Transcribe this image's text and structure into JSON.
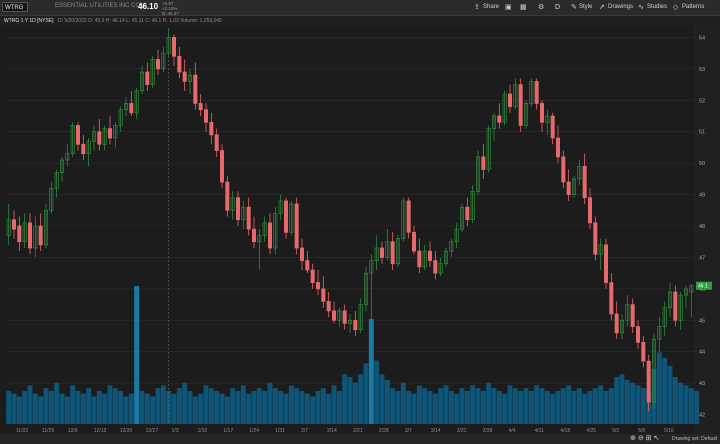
{
  "header": {
    "symbol": "WTRG",
    "company": "ESSENTIAL UTILITIES INC COM",
    "last_price": "46.10",
    "change_top": "+0.97",
    "change_mid": "+2.15%",
    "change_bot": "B: 46.07",
    "buttons": {
      "share": "Share",
      "style": "Style",
      "drawings": "Drawings",
      "studies": "Studies",
      "patterns": "Patterns"
    }
  },
  "subheader": {
    "symbol_label": "WTRG 1 Y 1D [NYSE]",
    "ohlc": "D: 5/20/2022   O: 45.9   H: 46.14   L: 45.11   C: 46.1   R: 1.03   Volume: 1,259,045"
  },
  "footer": {
    "drawing_set": "Drawing set: Default"
  },
  "colors": {
    "up": "#2e8b3e",
    "down": "#e8696c",
    "volume": "#0f5577",
    "volume_highlight": "#1a7aa8",
    "price_tag": "#2ea043"
  },
  "chart_data": {
    "type": "candlestick",
    "y_ticks": [
      54,
      53,
      52,
      51,
      50,
      49,
      48,
      47,
      46,
      45,
      44,
      43,
      42
    ],
    "ylim": [
      41.7,
      54.3
    ],
    "x_labels": [
      "11/22",
      "11/29",
      "12/6",
      "12/13",
      "12/20",
      "12/27",
      "1/3",
      "1/10",
      "1/17",
      "1/24",
      "1/31",
      "2/7",
      "2/14",
      "2/21",
      "2/28",
      "3/7",
      "3/14",
      "3/21",
      "3/28",
      "4/4",
      "4/11",
      "4/18",
      "4/25",
      "5/2",
      "5/9",
      "5/16"
    ],
    "last_price_tag": "46.1",
    "candles": [
      {
        "o": 47.7,
        "h": 48.7,
        "l": 47.4,
        "c": 48.2
      },
      {
        "o": 48.2,
        "h": 48.5,
        "l": 47.6,
        "c": 47.9
      },
      {
        "o": 48.0,
        "h": 48.3,
        "l": 47.2,
        "c": 47.5
      },
      {
        "o": 47.5,
        "h": 48.4,
        "l": 47.3,
        "c": 48.1
      },
      {
        "o": 48.1,
        "h": 48.4,
        "l": 47.1,
        "c": 47.3
      },
      {
        "o": 47.3,
        "h": 48.3,
        "l": 47.0,
        "c": 48.0
      },
      {
        "o": 48.0,
        "h": 48.4,
        "l": 47.2,
        "c": 47.4
      },
      {
        "o": 47.4,
        "h": 48.7,
        "l": 47.3,
        "c": 48.5
      },
      {
        "o": 48.5,
        "h": 49.4,
        "l": 48.4,
        "c": 49.2
      },
      {
        "o": 49.2,
        "h": 49.8,
        "l": 48.9,
        "c": 49.7
      },
      {
        "o": 49.7,
        "h": 50.2,
        "l": 49.4,
        "c": 50.1
      },
      {
        "o": 50.1,
        "h": 50.6,
        "l": 49.9,
        "c": 50.3
      },
      {
        "o": 50.3,
        "h": 51.3,
        "l": 50.2,
        "c": 51.2
      },
      {
        "o": 51.2,
        "h": 51.3,
        "l": 50.4,
        "c": 50.6
      },
      {
        "o": 50.6,
        "h": 50.9,
        "l": 50.1,
        "c": 50.3
      },
      {
        "o": 50.3,
        "h": 50.8,
        "l": 49.9,
        "c": 50.7
      },
      {
        "o": 50.7,
        "h": 51.2,
        "l": 50.4,
        "c": 51.0
      },
      {
        "o": 51.0,
        "h": 51.4,
        "l": 50.4,
        "c": 50.6
      },
      {
        "o": 50.6,
        "h": 51.2,
        "l": 50.4,
        "c": 51.1
      },
      {
        "o": 51.1,
        "h": 51.5,
        "l": 50.6,
        "c": 50.8
      },
      {
        "o": 50.8,
        "h": 51.3,
        "l": 50.5,
        "c": 51.2
      },
      {
        "o": 51.2,
        "h": 51.8,
        "l": 51.0,
        "c": 51.7
      },
      {
        "o": 51.7,
        "h": 52.1,
        "l": 51.5,
        "c": 51.9
      },
      {
        "o": 51.9,
        "h": 52.3,
        "l": 51.5,
        "c": 51.6
      },
      {
        "o": 51.6,
        "h": 52.4,
        "l": 51.4,
        "c": 52.3
      },
      {
        "o": 52.3,
        "h": 53.1,
        "l": 52.2,
        "c": 52.9
      },
      {
        "o": 52.9,
        "h": 53.2,
        "l": 52.3,
        "c": 52.5
      },
      {
        "o": 52.5,
        "h": 53.4,
        "l": 52.4,
        "c": 53.3
      },
      {
        "o": 53.3,
        "h": 53.6,
        "l": 52.8,
        "c": 53.0
      },
      {
        "o": 53.0,
        "h": 53.7,
        "l": 52.9,
        "c": 53.5
      },
      {
        "o": 53.5,
        "h": 54.3,
        "l": 53.4,
        "c": 54.0
      },
      {
        "o": 54.0,
        "h": 54.1,
        "l": 53.1,
        "c": 53.4
      },
      {
        "o": 53.4,
        "h": 53.7,
        "l": 52.7,
        "c": 52.9
      },
      {
        "o": 52.9,
        "h": 53.3,
        "l": 52.3,
        "c": 52.6
      },
      {
        "o": 52.6,
        "h": 53.0,
        "l": 52.2,
        "c": 52.8
      },
      {
        "o": 52.8,
        "h": 53.2,
        "l": 51.7,
        "c": 51.9
      },
      {
        "o": 51.9,
        "h": 52.2,
        "l": 51.5,
        "c": 51.7
      },
      {
        "o": 51.7,
        "h": 51.9,
        "l": 51.0,
        "c": 51.3
      },
      {
        "o": 51.3,
        "h": 51.6,
        "l": 50.6,
        "c": 50.9
      },
      {
        "o": 50.9,
        "h": 51.1,
        "l": 50.2,
        "c": 50.4
      },
      {
        "o": 50.4,
        "h": 50.6,
        "l": 49.2,
        "c": 49.4
      },
      {
        "o": 49.4,
        "h": 49.6,
        "l": 48.3,
        "c": 48.5
      },
      {
        "o": 48.5,
        "h": 49.1,
        "l": 48.2,
        "c": 48.9
      },
      {
        "o": 48.9,
        "h": 49.1,
        "l": 48.0,
        "c": 48.2
      },
      {
        "o": 48.2,
        "h": 48.8,
        "l": 47.9,
        "c": 48.6
      },
      {
        "o": 48.6,
        "h": 48.9,
        "l": 47.7,
        "c": 47.9
      },
      {
        "o": 47.9,
        "h": 48.3,
        "l": 47.3,
        "c": 47.5
      },
      {
        "o": 47.5,
        "h": 47.9,
        "l": 46.6,
        "c": 47.7
      },
      {
        "o": 47.7,
        "h": 48.3,
        "l": 47.5,
        "c": 48.1
      },
      {
        "o": 48.1,
        "h": 48.4,
        "l": 47.1,
        "c": 47.3
      },
      {
        "o": 47.3,
        "h": 48.6,
        "l": 47.1,
        "c": 48.4
      },
      {
        "o": 48.4,
        "h": 49.0,
        "l": 48.2,
        "c": 48.8
      },
      {
        "o": 48.8,
        "h": 48.9,
        "l": 47.6,
        "c": 47.8
      },
      {
        "o": 47.8,
        "h": 48.8,
        "l": 47.7,
        "c": 48.7
      },
      {
        "o": 48.7,
        "h": 48.9,
        "l": 47.1,
        "c": 47.3
      },
      {
        "o": 47.3,
        "h": 47.6,
        "l": 46.6,
        "c": 46.9
      },
      {
        "o": 46.9,
        "h": 47.2,
        "l": 46.5,
        "c": 46.6
      },
      {
        "o": 46.6,
        "h": 46.8,
        "l": 46.0,
        "c": 46.2
      },
      {
        "o": 46.2,
        "h": 46.6,
        "l": 45.8,
        "c": 46.0
      },
      {
        "o": 46.0,
        "h": 46.4,
        "l": 45.4,
        "c": 45.6
      },
      {
        "o": 45.6,
        "h": 45.9,
        "l": 45.1,
        "c": 45.3
      },
      {
        "o": 45.3,
        "h": 45.6,
        "l": 44.9,
        "c": 45.0
      },
      {
        "o": 45.0,
        "h": 45.4,
        "l": 44.8,
        "c": 45.3
      },
      {
        "o": 45.3,
        "h": 45.5,
        "l": 44.7,
        "c": 44.9
      },
      {
        "o": 44.9,
        "h": 45.2,
        "l": 44.6,
        "c": 45.0
      },
      {
        "o": 45.0,
        "h": 45.3,
        "l": 44.5,
        "c": 44.7
      },
      {
        "o": 44.7,
        "h": 45.7,
        "l": 44.6,
        "c": 45.5
      },
      {
        "o": 45.5,
        "h": 46.7,
        "l": 45.3,
        "c": 46.5
      },
      {
        "o": 46.5,
        "h": 47.1,
        "l": 44.2,
        "c": 46.9
      },
      {
        "o": 46.9,
        "h": 47.7,
        "l": 46.6,
        "c": 47.3
      },
      {
        "o": 47.3,
        "h": 47.5,
        "l": 46.8,
        "c": 47.0
      },
      {
        "o": 47.0,
        "h": 47.9,
        "l": 46.9,
        "c": 47.5
      },
      {
        "o": 47.5,
        "h": 47.8,
        "l": 46.6,
        "c": 46.8
      },
      {
        "o": 46.8,
        "h": 47.7,
        "l": 46.7,
        "c": 47.6
      },
      {
        "o": 47.6,
        "h": 48.9,
        "l": 47.5,
        "c": 48.8
      },
      {
        "o": 48.8,
        "h": 48.9,
        "l": 47.6,
        "c": 47.8
      },
      {
        "o": 47.8,
        "h": 48.0,
        "l": 47.1,
        "c": 47.2
      },
      {
        "o": 47.2,
        "h": 47.6,
        "l": 46.5,
        "c": 46.7
      },
      {
        "o": 46.7,
        "h": 47.4,
        "l": 46.6,
        "c": 47.2
      },
      {
        "o": 47.2,
        "h": 47.5,
        "l": 46.7,
        "c": 46.9
      },
      {
        "o": 46.9,
        "h": 47.2,
        "l": 46.3,
        "c": 46.5
      },
      {
        "o": 46.5,
        "h": 47.0,
        "l": 46.4,
        "c": 46.8
      },
      {
        "o": 46.8,
        "h": 47.3,
        "l": 46.7,
        "c": 47.2
      },
      {
        "o": 47.2,
        "h": 47.6,
        "l": 47.0,
        "c": 47.5
      },
      {
        "o": 47.5,
        "h": 48.1,
        "l": 47.3,
        "c": 47.9
      },
      {
        "o": 47.9,
        "h": 48.7,
        "l": 47.8,
        "c": 48.6
      },
      {
        "o": 48.6,
        "h": 48.9,
        "l": 48.0,
        "c": 48.2
      },
      {
        "o": 48.2,
        "h": 49.3,
        "l": 48.1,
        "c": 49.1
      },
      {
        "o": 49.1,
        "h": 50.4,
        "l": 49.0,
        "c": 50.2
      },
      {
        "o": 50.2,
        "h": 50.6,
        "l": 49.5,
        "c": 49.8
      },
      {
        "o": 49.8,
        "h": 51.2,
        "l": 49.7,
        "c": 51.1
      },
      {
        "o": 51.1,
        "h": 51.6,
        "l": 50.7,
        "c": 51.5
      },
      {
        "o": 51.5,
        "h": 51.9,
        "l": 51.1,
        "c": 51.3
      },
      {
        "o": 51.3,
        "h": 52.3,
        "l": 51.2,
        "c": 52.2
      },
      {
        "o": 52.2,
        "h": 52.5,
        "l": 51.6,
        "c": 51.8
      },
      {
        "o": 51.8,
        "h": 52.7,
        "l": 51.7,
        "c": 52.5
      },
      {
        "o": 52.5,
        "h": 52.7,
        "l": 51.0,
        "c": 51.2
      },
      {
        "o": 51.2,
        "h": 52.0,
        "l": 51.1,
        "c": 51.9
      },
      {
        "o": 51.9,
        "h": 52.7,
        "l": 51.8,
        "c": 52.6
      },
      {
        "o": 52.6,
        "h": 52.7,
        "l": 51.7,
        "c": 51.9
      },
      {
        "o": 51.9,
        "h": 52.0,
        "l": 51.0,
        "c": 51.3
      },
      {
        "o": 51.3,
        "h": 51.7,
        "l": 50.9,
        "c": 51.5
      },
      {
        "o": 51.5,
        "h": 51.6,
        "l": 50.6,
        "c": 50.8
      },
      {
        "o": 50.8,
        "h": 51.2,
        "l": 50.0,
        "c": 50.2
      },
      {
        "o": 50.2,
        "h": 50.4,
        "l": 49.2,
        "c": 49.4
      },
      {
        "o": 49.4,
        "h": 49.8,
        "l": 48.8,
        "c": 49.0
      },
      {
        "o": 49.0,
        "h": 49.6,
        "l": 48.9,
        "c": 49.5
      },
      {
        "o": 49.5,
        "h": 50.1,
        "l": 49.3,
        "c": 49.9
      },
      {
        "o": 49.9,
        "h": 50.3,
        "l": 48.7,
        "c": 48.9
      },
      {
        "o": 48.9,
        "h": 49.2,
        "l": 47.9,
        "c": 48.1
      },
      {
        "o": 48.1,
        "h": 48.3,
        "l": 46.9,
        "c": 47.1
      },
      {
        "o": 47.1,
        "h": 47.6,
        "l": 46.6,
        "c": 47.4
      },
      {
        "o": 47.4,
        "h": 47.6,
        "l": 46.0,
        "c": 46.2
      },
      {
        "o": 46.2,
        "h": 46.5,
        "l": 45.0,
        "c": 45.2
      },
      {
        "o": 45.2,
        "h": 45.6,
        "l": 44.4,
        "c": 44.6
      },
      {
        "o": 44.6,
        "h": 45.2,
        "l": 44.4,
        "c": 45.0
      },
      {
        "o": 45.0,
        "h": 45.8,
        "l": 44.8,
        "c": 45.5
      },
      {
        "o": 45.5,
        "h": 45.7,
        "l": 44.6,
        "c": 44.8
      },
      {
        "o": 44.8,
        "h": 45.0,
        "l": 44.1,
        "c": 44.3
      },
      {
        "o": 44.3,
        "h": 44.5,
        "l": 43.5,
        "c": 43.7
      },
      {
        "o": 43.7,
        "h": 43.9,
        "l": 42.1,
        "c": 42.4
      },
      {
        "o": 42.4,
        "h": 44.6,
        "l": 42.2,
        "c": 44.4
      },
      {
        "o": 44.4,
        "h": 45.1,
        "l": 44.0,
        "c": 44.8
      },
      {
        "o": 44.8,
        "h": 45.6,
        "l": 44.5,
        "c": 45.4
      },
      {
        "o": 45.4,
        "h": 46.2,
        "l": 45.1,
        "c": 45.9
      },
      {
        "o": 45.9,
        "h": 46.1,
        "l": 44.8,
        "c": 45.0
      },
      {
        "o": 45.0,
        "h": 45.9,
        "l": 44.7,
        "c": 45.8
      },
      {
        "o": 45.8,
        "h": 46.1,
        "l": 45.4,
        "c": 46.0
      },
      {
        "o": 45.9,
        "h": 46.14,
        "l": 45.11,
        "c": 46.1
      }
    ],
    "volume": [
      0.12,
      0.11,
      0.1,
      0.12,
      0.14,
      0.11,
      0.1,
      0.13,
      0.12,
      0.15,
      0.11,
      0.1,
      0.14,
      0.12,
      0.11,
      0.13,
      0.1,
      0.12,
      0.11,
      0.14,
      0.13,
      0.12,
      0.1,
      0.11,
      0.5,
      0.12,
      0.11,
      0.1,
      0.13,
      0.14,
      0.12,
      0.11,
      0.13,
      0.15,
      0.12,
      0.1,
      0.11,
      0.14,
      0.13,
      0.12,
      0.11,
      0.1,
      0.13,
      0.12,
      0.14,
      0.11,
      0.12,
      0.13,
      0.12,
      0.15,
      0.13,
      0.12,
      0.11,
      0.14,
      0.13,
      0.12,
      0.11,
      0.1,
      0.12,
      0.13,
      0.11,
      0.14,
      0.12,
      0.18,
      0.17,
      0.15,
      0.18,
      0.22,
      0.38,
      0.23,
      0.18,
      0.16,
      0.13,
      0.12,
      0.15,
      0.12,
      0.11,
      0.14,
      0.13,
      0.12,
      0.11,
      0.13,
      0.14,
      0.12,
      0.11,
      0.13,
      0.12,
      0.14,
      0.13,
      0.12,
      0.15,
      0.13,
      0.12,
      0.11,
      0.14,
      0.13,
      0.12,
      0.13,
      0.12,
      0.14,
      0.13,
      0.12,
      0.11,
      0.12,
      0.13,
      0.14,
      0.12,
      0.13,
      0.11,
      0.12,
      0.13,
      0.14,
      0.12,
      0.13,
      0.17,
      0.18,
      0.16,
      0.15,
      0.14,
      0.13,
      0.12,
      0.2,
      0.26,
      0.24,
      0.21,
      0.17,
      0.15,
      0.14,
      0.13,
      0.12
    ]
  }
}
